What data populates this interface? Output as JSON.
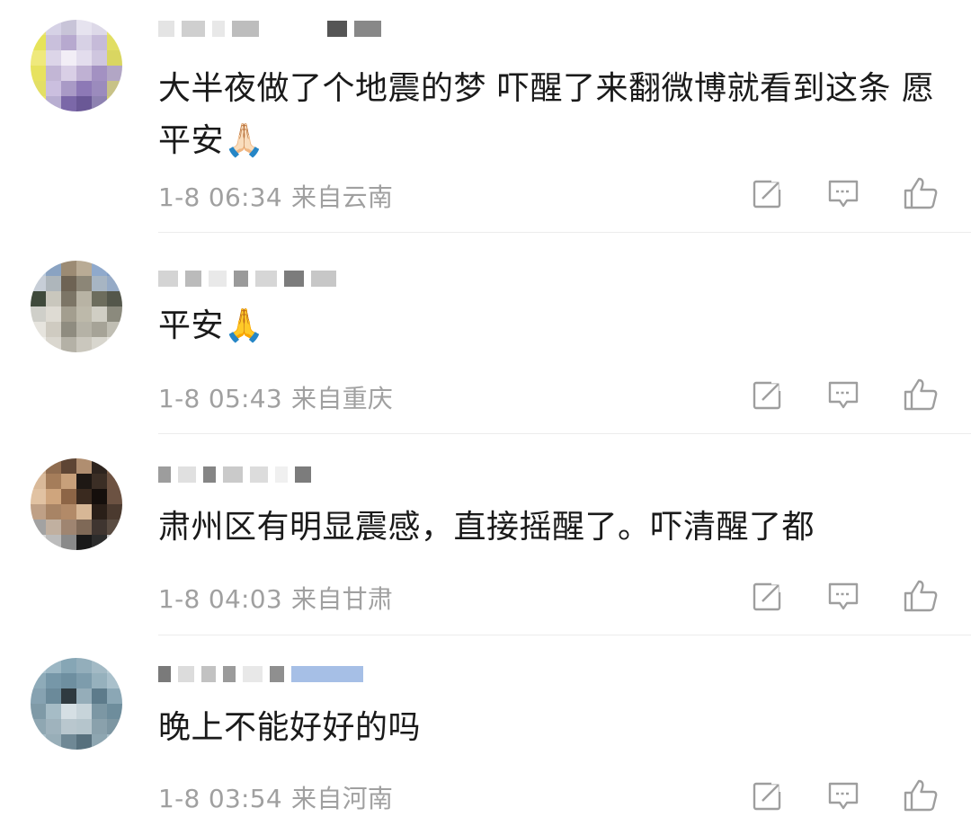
{
  "comments": [
    {
      "text": "大半夜做了个地震的梦  吓醒了来翻微博就看到这条  愿平安🙏🏻",
      "time": "1-8 06:34",
      "location": "来自云南",
      "avatar_colors": [
        "#e9e37a",
        "#d6d2e6",
        "#c8c4d8",
        "#e6e3ef",
        "#ddd9e8",
        "#e8e46e",
        "#e6e35a",
        "#c9c0dc",
        "#b7a9cf",
        "#d7d1e5",
        "#c6bbd9",
        "#e1de63",
        "#efe97c",
        "#dcd5e8",
        "#f2eef6",
        "#e3dded",
        "#cfc6df",
        "#d9d661",
        "#e7e25f",
        "#c2b6d5",
        "#d9cfe6",
        "#bfb1d3",
        "#a391c2",
        "#b2a6c5",
        "#e3df65",
        "#cbbfdf",
        "#a99ac6",
        "#8d79b6",
        "#9b8bbd",
        "#c8c287",
        "#ece66a",
        "#b8aed1",
        "#7b68a8",
        "#6a5896",
        "#8e82b1",
        "#d3cf76"
      ],
      "username_blocks": [
        "#e4e4e4",
        "#cfcfcf",
        "#e8e8e8",
        "#bdbdbd",
        "#ffffff",
        "#555555",
        "#888888"
      ]
    },
    {
      "text": "平安🙏",
      "time": "1-8 05:43",
      "location": "来自重庆",
      "avatar_colors": [
        "#b8c9db",
        "#8aa3c2",
        "#9c8b74",
        "#b9ab95",
        "#8fa9cc",
        "#7f9dc5",
        "#c7ced7",
        "#aeb6bb",
        "#6e6354",
        "#8c8677",
        "#a7b5c3",
        "#95aac6",
        "#3f4a3c",
        "#c9c7bd",
        "#7c7566",
        "#b8b3a4",
        "#6d6d5d",
        "#54574b",
        "#cfcfc9",
        "#dedbd3",
        "#a39e8f",
        "#bdb9aa",
        "#d0cec4",
        "#8b8a7d",
        "#e6e4de",
        "#cfcbc1",
        "#8f8c80",
        "#b5b2a6",
        "#a6a397",
        "#c0beb3",
        "#efeeea",
        "#dad7cf",
        "#b4b1a6",
        "#cac7bd",
        "#d8d6ce",
        "#e5e3dd"
      ],
      "username_blocks": [
        "#d4d4d4",
        "#bbbbbb",
        "#e9e9e9",
        "#9a9a9a",
        "#d6d6d6",
        "#7c7c7c",
        "#c7c7c7"
      ]
    },
    {
      "text": "肃州区有明显震感，直接摇醒了。吓清醒了都",
      "time": "1-8 04:03",
      "location": "来自甘肃",
      "avatar_colors": [
        "#c9a98a",
        "#8f6c4f",
        "#5e4534",
        "#b08e70",
        "#2e241e",
        "#7a5c45",
        "#d9b999",
        "#a57d5a",
        "#c8a07a",
        "#1e1814",
        "#3b2e25",
        "#6d5241",
        "#e1c2a2",
        "#cfa57d",
        "#8d6546",
        "#3a2a1f",
        "#150f0c",
        "#6c5242",
        "#bfa086",
        "#a88465",
        "#b28a68",
        "#d7b796",
        "#2a1f18",
        "#4b3a2f",
        "#a2a2a2",
        "#c1b0a0",
        "#9f8571",
        "#7f6957",
        "#3f3530",
        "#5a4c42",
        "#d6d6d6",
        "#bcbcbc",
        "#8a8a8a",
        "#191919",
        "#2c2c2c",
        "#c2c2c2"
      ],
      "username_blocks": [
        "#9d9d9d",
        "#e0e0e0",
        "#858585",
        "#cacaca",
        "#dcdcdc",
        "#f0f0f0",
        "#7c7c7c"
      ]
    },
    {
      "text": "晚上不能好好的吗",
      "time": "1-8 03:54",
      "location": "来自河南",
      "avatar_colors": [
        "#a8c0cc",
        "#9cb7c4",
        "#86a6b5",
        "#93aebb",
        "#a3bac5",
        "#b7cbd4",
        "#8eabb9",
        "#7697a8",
        "#6e8fa0",
        "#7d9cac",
        "#96b1bd",
        "#a9c0cb",
        "#86a2b1",
        "#6b8a9a",
        "#2f3a40",
        "#95adb9",
        "#5d7b8b",
        "#8ba7b5",
        "#7f9aa7",
        "#a6bcc6",
        "#d5dfe4",
        "#c7d4da",
        "#7c97a4",
        "#6e8d9c",
        "#8fa7b2",
        "#9fb3bd",
        "#b9c7ce",
        "#b5c5cc",
        "#8aa1ac",
        "#7d96a2",
        "#a7bcc6",
        "#98aeb8",
        "#6f8895",
        "#57707d",
        "#8ea6b1",
        "#a9bec8"
      ],
      "username_blocks": [
        "#7a7a7a",
        "#dcdcdc",
        "#c2c2c2",
        "#9b9b9b",
        "#e8e8e8",
        "#8f8f8f",
        "#a6bfe6"
      ]
    }
  ]
}
